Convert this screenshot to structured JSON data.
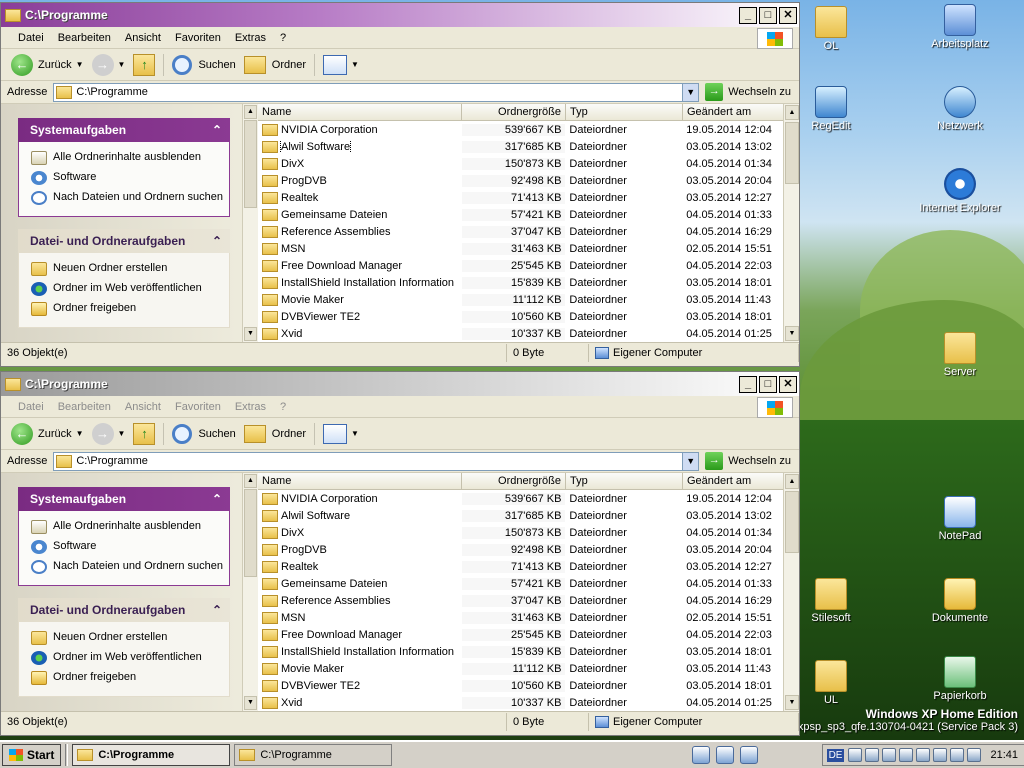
{
  "desktop": {
    "icons": [
      {
        "label": "OL",
        "kind": "folder"
      },
      {
        "label": "Arbeitsplatz",
        "kind": "pc"
      },
      {
        "label": "RegEdit",
        "kind": "reg"
      },
      {
        "label": "Netzwerk",
        "kind": "net"
      },
      {
        "label": "Internet Explorer",
        "kind": "ie"
      },
      {
        "label": "Server",
        "kind": "folder"
      },
      {
        "label": "NotePad",
        "kind": "note"
      },
      {
        "label": "Stilesoft",
        "kind": "folder"
      },
      {
        "label": "Dokumente",
        "kind": "docs"
      },
      {
        "label": "UL",
        "kind": "folder"
      },
      {
        "label": "Papierkorb",
        "kind": "bin"
      }
    ],
    "edition_title": "Windows XP Home Edition",
    "edition_build": "xpsp_sp3_qfe.130704-0421 (Service Pack 3)"
  },
  "window": {
    "title": "C:\\Programme",
    "controls": {
      "minimize": "_",
      "maximize": "□",
      "close": "✕"
    },
    "menu": [
      "Datei",
      "Bearbeiten",
      "Ansicht",
      "Favoriten",
      "Extras",
      "?"
    ],
    "toolbar": {
      "back": "Zurück",
      "search": "Suchen",
      "folders": "Ordner"
    },
    "address": {
      "label": "Adresse",
      "value": "C:\\Programme",
      "go": "Wechseln zu"
    },
    "tasks": {
      "system_title": "Systemaufgaben",
      "system_items": [
        "Alle Ordnerinhalte ausblenden",
        "Software",
        "Nach Dateien und Ordnern suchen"
      ],
      "file_title": "Datei- und Ordneraufgaben",
      "file_items": [
        "Neuen Ordner erstellen",
        "Ordner im Web veröffentlichen",
        "Ordner freigeben"
      ]
    },
    "columns": [
      "Name",
      "Ordnergröße",
      "Typ",
      "Geändert am"
    ],
    "rows": [
      [
        "NVIDIA Corporation",
        "539'667 KB",
        "Dateiordner",
        "19.05.2014 12:04"
      ],
      [
        "Alwil Software",
        "317'685 KB",
        "Dateiordner",
        "03.05.2014 13:02"
      ],
      [
        "DivX",
        "150'873 KB",
        "Dateiordner",
        "04.05.2014 01:34"
      ],
      [
        "ProgDVB",
        "92'498 KB",
        "Dateiordner",
        "03.05.2014 20:04"
      ],
      [
        "Realtek",
        "71'413 KB",
        "Dateiordner",
        "03.05.2014 12:27"
      ],
      [
        "Gemeinsame Dateien",
        "57'421 KB",
        "Dateiordner",
        "04.05.2014 01:33"
      ],
      [
        "Reference Assemblies",
        "37'047 KB",
        "Dateiordner",
        "04.05.2014 16:29"
      ],
      [
        "MSN",
        "31'463 KB",
        "Dateiordner",
        "02.05.2014 15:51"
      ],
      [
        "Free Download Manager",
        "25'545 KB",
        "Dateiordner",
        "04.05.2014 22:03"
      ],
      [
        "InstallShield Installation Information",
        "15'839 KB",
        "Dateiordner",
        "03.05.2014 18:01"
      ],
      [
        "Movie Maker",
        "11'112 KB",
        "Dateiordner",
        "03.05.2014 11:43"
      ],
      [
        "DVBViewer TE2",
        "10'560 KB",
        "Dateiordner",
        "03.05.2014 18:01"
      ],
      [
        "Xvid",
        "10'337 KB",
        "Dateiordner",
        "04.05.2014 01:25"
      ]
    ],
    "status": {
      "count": "36 Objekt(e)",
      "size": "0 Byte",
      "location": "Eigener Computer"
    }
  },
  "taskbar": {
    "start": "Start",
    "tasks": [
      "C:\\Programme",
      "C:\\Programme"
    ],
    "language": "DE",
    "clock": "21:41"
  }
}
